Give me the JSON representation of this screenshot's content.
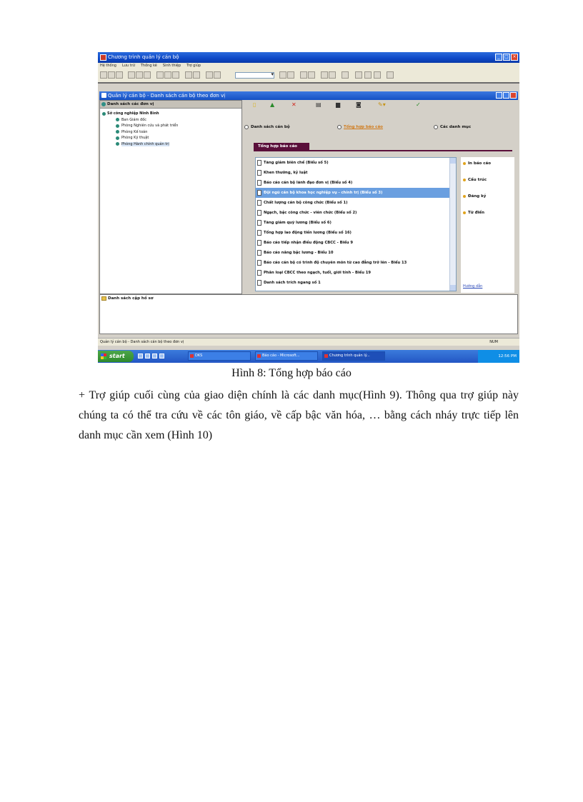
{
  "window": {
    "title": "Chương trình quản lý cán bộ",
    "menu": [
      "Hệ thống",
      "Lưu trữ",
      "Thống kê",
      "Sinh thiệp",
      "Trợ giúp"
    ]
  },
  "child_window": {
    "title": "Quản lý cán bộ - Danh sách cán bộ theo đơn vị"
  },
  "left_panel": {
    "header": "Danh sách các đơn vị",
    "tree_root": "Sở công nghiệp Ninh Bình",
    "tree_children": [
      "Ban Giám đốc",
      "Phòng Nghiên cứu và phát triển",
      "Phòng Kế toán",
      "Phòng Kỹ thuật",
      "Phòng Hành chính quản trị"
    ],
    "selected_child": 4
  },
  "bottom_panel": {
    "header": "Danh sách cập hồ sơ"
  },
  "right_panel": {
    "radios": [
      {
        "label": "Danh sách cán bộ",
        "selected": false
      },
      {
        "label": "Tổng hợp báo cáo",
        "selected": true
      },
      {
        "label": "Các danh mục",
        "selected": false
      }
    ],
    "tab": "Tổng hợp báo cáo",
    "reports": [
      "Tăng giảm biên chế (Biểu số 5)",
      "Khen thưởng, kỷ luật",
      "Báo cáo cán bộ lãnh đạo đơn vị (Biểu số 4)",
      "Đội ngũ cán bộ khoa học nghiệp vụ - chính trị (Biểu số 3)",
      "Chất lượng cán bộ công chức (Biểu số 1)",
      "Ngạch, bậc công chức - viên chức (Biểu số 2)",
      "Tăng giảm quỹ lương (Biểu số 6)",
      "Tổng hợp lao động tiền lương (Biểu số 16)",
      "Báo cáo tiếp nhận điều động CBCC - Biểu 9",
      "Báo cáo nâng bậc lương - Biểu 10",
      "Báo cáo cán bộ có trình độ chuyên môn từ cao đẳng trở lên - Biểu 13",
      "Phân loại CBCC theo ngạch, tuổi, giới tính - Biểu 19",
      "Danh sách trích ngang số 1"
    ],
    "selected_report": 3,
    "actions": [
      "In báo cáo",
      "Cấu trúc",
      "Đăng ký",
      "Từ điển"
    ],
    "help_link": "Hướng dẫn"
  },
  "statusbar": {
    "left": "Quản lý cán bộ - Danh sách cán bộ theo đơn vị",
    "right": "NUM"
  },
  "taskbar": {
    "start": "start",
    "tasks": [
      "DKS",
      "Báo cáo - Microsoft...",
      "Chương trình quản lý..."
    ],
    "clock": "12:56 PM"
  },
  "document": {
    "caption": "Hình 8: Tổng hợp báo cáo",
    "paragraph": "+ Trợ giúp cuối cùng của giao diện chính là các danh mục(Hình 9). Thông qua trợ giúp này chúng ta có thể tra cứu về các tôn giáo, về cấp bậc văn hóa, … bằng cách nháy trực tiếp lên danh mục cần xem (Hình 10)"
  }
}
